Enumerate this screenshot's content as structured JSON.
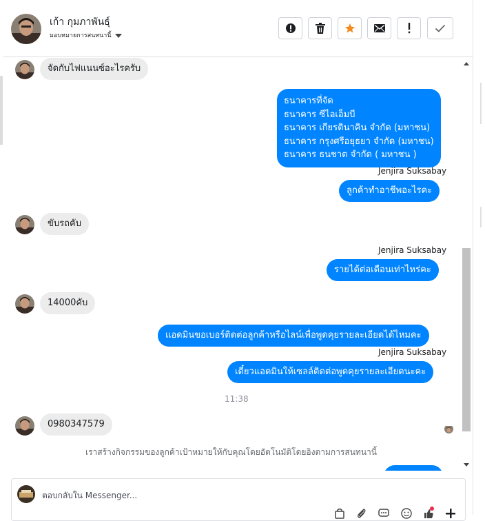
{
  "header": {
    "contact_name": "เก้า กุมภาพันธุ์",
    "assignee_label": "มอบหมายการสนทนานี้",
    "buttons": [
      {
        "name": "report-button",
        "icon": "exclamation-circle-icon"
      },
      {
        "name": "delete-button",
        "icon": "trash-icon"
      },
      {
        "name": "star-button",
        "icon": "star-icon"
      },
      {
        "name": "mark-unread-button",
        "icon": "envelope-icon"
      },
      {
        "name": "spam-button",
        "icon": "exclamation-icon"
      },
      {
        "name": "done-button",
        "icon": "check-icon"
      }
    ]
  },
  "colors": {
    "outgoing": "#0084ff",
    "incoming": "#ececec",
    "star": "#f68a1e"
  },
  "messages": {
    "m1": "จัดกับไฟแนนซ์อะไรครับ",
    "m2_lines": [
      "ธนาคารที่จัด",
      "ธนาคาร ซีไอเอ็มบี",
      "ธนาคาร เกียรตินาคิน จำกัด (มหาชน)",
      "ธนาคาร กรุงศรีอยุธยา จำกัด (มหาชน)",
      "ธนาคาร ธนชาต จำกัด ( มหาชน )"
    ],
    "sender1": "Jenjira Suksabay",
    "m3": "ลูกค้าทำอาชีพอะไรคะ",
    "m4": "ขับรถคับ",
    "sender2": "Jenjira Suksabay",
    "m5": "รายได้ต่อเดือนเท่าไหร่คะ",
    "m6": "14000คับ",
    "m7": "แอดมินขอเบอร์ติดต่อลูกค้าหรือไลน์เพื่อพูดคุยรายละเอียดได้ไหมคะ",
    "sender3": "Jenjira Suksabay",
    "m8": "เดี๋ยวแอดมินให้เซลล์ติดต่อพูดคุยรายละเอียดนะคะ",
    "timestamp": "11:38",
    "m9": "0980347579",
    "system_notice": "เราสร้างกิจกรรมของลูกค้าเป้าหมายให้กับคุณโดยอัตโนมัติโดยอิงตามการสนทนานี้"
  },
  "composer": {
    "placeholder": "ตอบกลับใน Messenger...",
    "icons": [
      "bag-icon",
      "paperclip-icon",
      "saved-reply-icon",
      "emoji-icon",
      "thumbs-up-icon",
      "more-icon"
    ]
  }
}
